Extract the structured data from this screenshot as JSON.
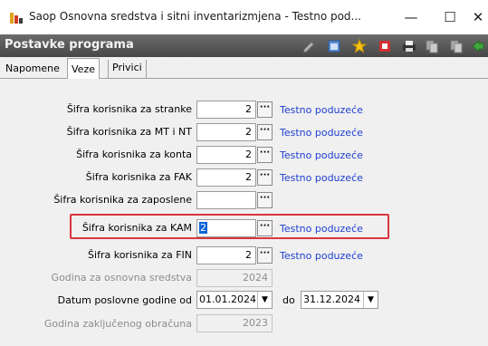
{
  "window": {
    "title": "Saop Osnovna sredstva i sitni inventarizmjena  - Testno pod...",
    "controls": {
      "minimize": "—",
      "maximize": "☐",
      "close": "✕"
    }
  },
  "header": {
    "title": "Postavke programa",
    "toolbar_icons": [
      "edit-icon",
      "grid-icon",
      "star-icon",
      "close-doc-icon",
      "print-icon",
      "copy-icon",
      "copy-alt-icon",
      "exit-icon"
    ]
  },
  "tabs": [
    {
      "label": "Napomene",
      "active": false
    },
    {
      "label": "Veze",
      "active": true
    },
    {
      "label": "Privici",
      "active": false
    }
  ],
  "form": {
    "rows": [
      {
        "label": "Šifra korisnika za stranke",
        "value": "2",
        "lookup": "···",
        "desc": "Testno poduzeće"
      },
      {
        "label": "Šifra korisnika za MT i NT",
        "value": "2",
        "lookup": "···",
        "desc": "Testno poduzeće"
      },
      {
        "label": "Šifra korisnika za konta",
        "value": "2",
        "lookup": "···",
        "desc": "Testno poduzeće"
      },
      {
        "label": "Šifra korisnika za FAK",
        "value": "2",
        "lookup": "···",
        "desc": "Testno poduzeće"
      },
      {
        "label": "Šifra korisnika za zaposlene",
        "value": "",
        "lookup": "···",
        "desc": ""
      },
      {
        "label": "Šifra korisnika za KAM",
        "value": "2",
        "lookup": "···",
        "desc": "Testno poduzeće"
      },
      {
        "label": "Šifra korisnika za FIN",
        "value": "2",
        "lookup": "···",
        "desc": "Testno poduzeće"
      }
    ],
    "year_label": "Godina za osnovna sredstva",
    "year_value": "2024",
    "date_label": "Datum poslovne godine od",
    "date_from": "01.01.2024",
    "date_to_label": "do",
    "date_to": "31.12.2024",
    "closing_label": "Godina zaključenog obračuna",
    "closing_value": "2023"
  },
  "colors": {
    "accent": "#1f3fd0",
    "highlight": "#d9363e",
    "header": "#555555"
  }
}
